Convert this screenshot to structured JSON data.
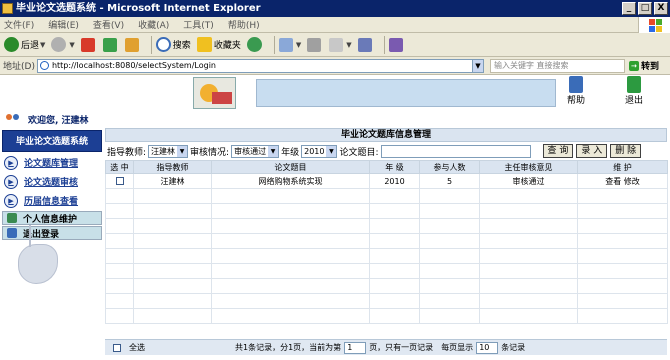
{
  "window": {
    "title": "毕业论文选题系统 - Microsoft Internet Explorer",
    "min": "_",
    "max": "□",
    "close": "X"
  },
  "menu": [
    "文件(F)",
    "编辑(E)",
    "查看(V)",
    "收藏(A)",
    "工具(T)",
    "帮助(H)"
  ],
  "toolbar": {
    "back": "后退",
    "search": "搜索",
    "favorites": "收藏夹"
  },
  "address": {
    "label": "地址(D)",
    "url": "http://localhost:8080/selectSystem/Login",
    "keyword_placeholder": "输入关键字 直接搜索",
    "go": "转到"
  },
  "header": {
    "help": "帮助",
    "exit": "退出"
  },
  "welcome": "欢迎您, 汪建林",
  "sidebar": {
    "title": "毕业论文选题系统",
    "items": [
      "论文题库管理",
      "论文选题审核",
      "历届信息查看"
    ],
    "subitems": [
      "个人信息维护",
      "退出登录"
    ]
  },
  "main": {
    "title": "毕业论文题库信息管理",
    "filters": {
      "advisor_label": "指导教师:",
      "advisor_value": "汪建林",
      "review_label": "审核情况:",
      "review_value": "审核通过",
      "year_label": "年级",
      "year_value": "2010",
      "topic_label": "论文题目:"
    },
    "buttons": [
      "查 询",
      "录 入",
      "删 除"
    ],
    "columns": [
      "选 中",
      "指导教师",
      "论文题目",
      "年 级",
      "参与人数",
      "主任审核意见",
      "维 护"
    ],
    "rows": [
      {
        "advisor": "汪建林",
        "topic": "网络购物系统实现",
        "year": "2010",
        "count": "5",
        "review": "审核通过",
        "view": "查看",
        "edit": "修改"
      }
    ],
    "footer": {
      "select_all": "全选",
      "text1": "共1条记录，分1页，当前为第",
      "page": "1",
      "text2": "页，只有一页记录",
      "per_page_label": "每页显示",
      "per_page": "10",
      "text3": "条记录"
    }
  }
}
